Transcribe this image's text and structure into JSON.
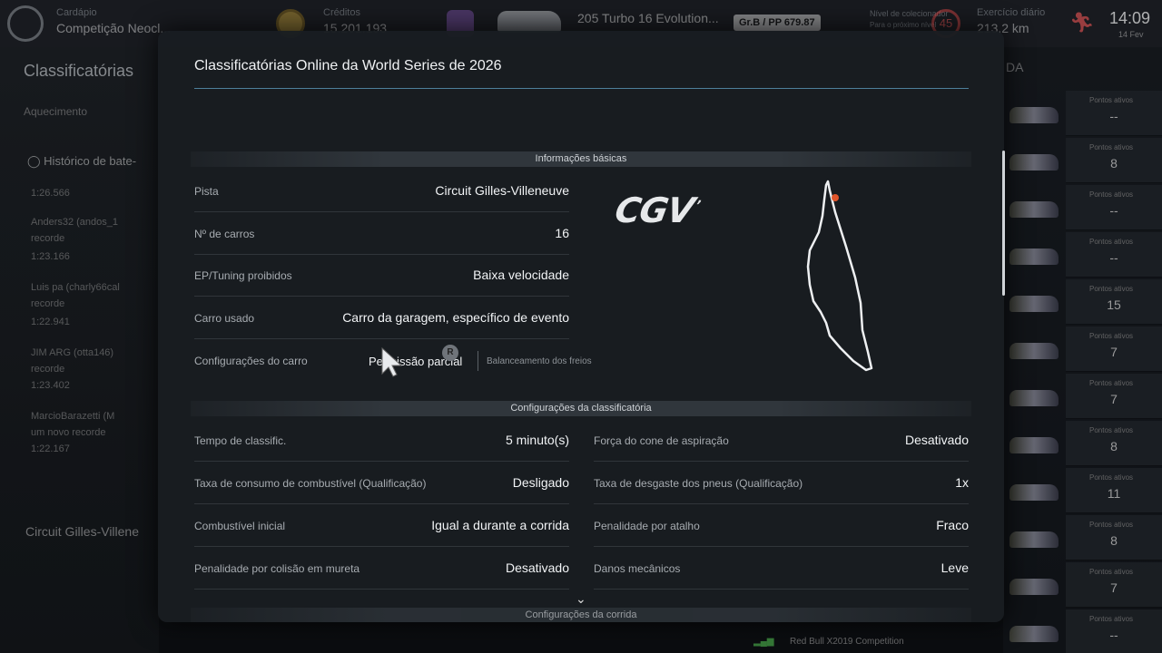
{
  "topbar": {
    "menu_label": "Cardápio",
    "menu_value": "Competição Neocl...",
    "credits_label": "Créditos",
    "credits_value": "15.201.193",
    "car_name": "205 Turbo 16 Evolution...",
    "car_class": "Gr.B / PP 679.87",
    "collector_label": "Nível de colecionador",
    "collector_sub": "Para o próximo nível",
    "collector_level": "45",
    "daily_label": "Exercício diário",
    "daily_value": "213,2 km",
    "clock": "14:09",
    "date": "14 Fev"
  },
  "background_left": {
    "title": "Classificatórias",
    "subtitle": "Aquecimento",
    "history": "Histórico de bate-",
    "items": [
      "1:26.566",
      "Anders32 (andos_1",
      "recorde",
      "1:23.166",
      "Luis pa (charly66cal",
      "recorde",
      "1:22.941",
      "JIM ARG (otta146)",
      "recorde",
      "1:23.402",
      "MarcioBarazetti (M",
      "um novo recorde",
      "1:22.167"
    ],
    "circuit": "Circuit Gilles-Villene"
  },
  "background_right": {
    "header_label": "DA",
    "points_label": "Pontos ativos",
    "points": [
      "--",
      "8",
      "--",
      "--",
      "15",
      "7",
      "7",
      "8",
      "11",
      "8",
      "7",
      "--"
    ],
    "bottom_car": "Red Bull X2019 Competition"
  },
  "modal": {
    "title": "Classificatórias Online da World Series de 2026",
    "basic_section": "Informações básicas",
    "basic": [
      {
        "key": "Pista",
        "value": "Circuit Gilles-Villeneuve"
      },
      {
        "key": "Nº de carros",
        "value": "16"
      },
      {
        "key": "EP/Tuning proibidos",
        "value": "Baixa velocidade"
      },
      {
        "key": "Carro usado",
        "value": "Carro da garagem, específico de evento"
      }
    ],
    "car_settings": {
      "key": "Configurações do carro",
      "value": "Permissão parcial",
      "button": "R",
      "detail": "Balanceamento dos freios"
    },
    "track_logo": "CGV",
    "qual_section": "Configurações da classificatória",
    "qual_left": [
      {
        "key": "Tempo de classific.",
        "value": "5 minuto(s)"
      },
      {
        "key": "Taxa de consumo de combustível (Qualificação)",
        "value": "Desligado"
      },
      {
        "key": "Combustível inicial",
        "value": "Igual a durante a corrida"
      },
      {
        "key": "Penalidade por colisão em mureta",
        "value": "Desativado"
      }
    ],
    "qual_right": [
      {
        "key": "Força do cone de aspiração",
        "value": "Desativado"
      },
      {
        "key": "Taxa de desgaste dos pneus (Qualificação)",
        "value": "1x"
      },
      {
        "key": "Penalidade por atalho",
        "value": "Fraco"
      },
      {
        "key": "Danos mecânicos",
        "value": "Leve"
      }
    ],
    "race_section": "Configurações da corrida"
  },
  "colors": {
    "modal_bg": "#191d21",
    "accent_rule": "#4d7f9a",
    "track_dot": "#e0552b"
  },
  "icons": {
    "logo": "gt-logo-icon",
    "credits": "coin-icon",
    "collector": "level-badge-icon",
    "daily": "runner-icon",
    "scroll_hint": "chevron-down-icon",
    "cursor": "pointer-cursor-icon"
  }
}
